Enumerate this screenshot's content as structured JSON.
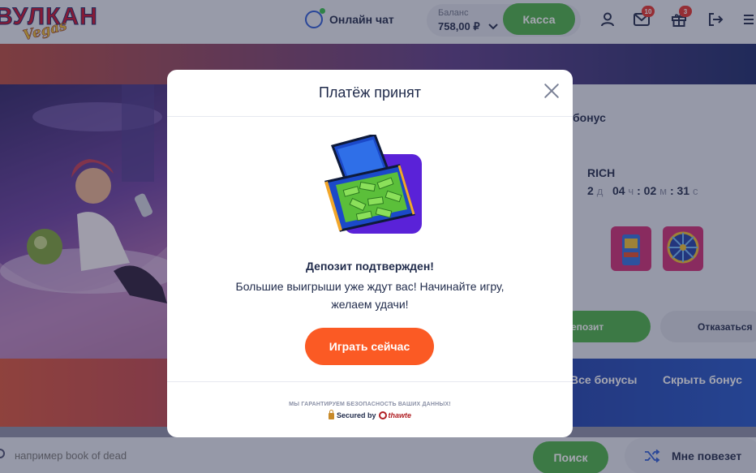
{
  "header": {
    "logo_text": "ВУЛКАН",
    "logo_sub": "Vegas",
    "chat_label": "Онлайн чат",
    "balance_caption": "Баланс",
    "balance_value": "758,00 ₽",
    "cashier_label": "Касса",
    "messages_badge": "10",
    "gifts_badge": "3"
  },
  "background": {
    "bonus_title_fragment": "бонус",
    "tournament_name": "RICH",
    "timer": [
      {
        "value": "2",
        "unit": "д"
      },
      {
        "value": "04",
        "unit": "ч"
      },
      {
        "value": "02",
        "unit": "м"
      },
      {
        "value": "31",
        "unit": "с"
      }
    ],
    "deposit_label": "епозит",
    "decline_label": "Отказаться",
    "all_bonuses": "Все бонусы",
    "hide_bonus": "Скрыть бонус",
    "search_placeholder": "например book of dead",
    "search_button": "Поиск",
    "lucky_button": "Мне повезет"
  },
  "modal": {
    "title": "Платёж принят",
    "message_title": "Депозит подтвержден!",
    "message_body": "Большие выигрыши уже ждут вас! Начинайте игру, желаем удачи!",
    "play_button": "Играть сейчас",
    "security_note": "МЫ ГАРАНТИРУЕМ БЕЗОПАСНОСТЬ ВАШИХ ДАННЫХ!",
    "secured_by": "Secured by",
    "security_brand": "thawte"
  },
  "colors": {
    "accent_green": "#4bb248",
    "play_orange": "#fb5a24",
    "badge_red": "#e3312b",
    "text_dark": "#1f2a4a"
  }
}
